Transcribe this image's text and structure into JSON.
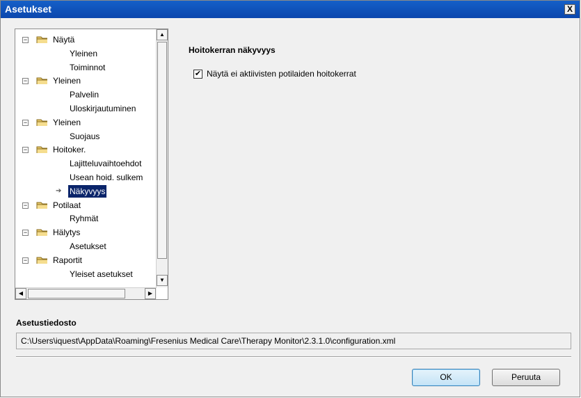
{
  "window": {
    "title": "Asetukset",
    "close_label": "X"
  },
  "tree": {
    "items": [
      {
        "label": "Näytä",
        "level": 0
      },
      {
        "label": "Yleinen",
        "level": 1
      },
      {
        "label": "Toiminnot",
        "level": 1
      },
      {
        "label": "Yleinen",
        "level": 0
      },
      {
        "label": "Palvelin",
        "level": 1
      },
      {
        "label": "Uloskirjautuminen",
        "level": 1
      },
      {
        "label": "Yleinen",
        "level": 0
      },
      {
        "label": "Suojaus",
        "level": 1
      },
      {
        "label": "Hoitoker.",
        "level": 0
      },
      {
        "label": "Lajitteluvaihtoehdot",
        "level": 1
      },
      {
        "label": "Usean hoid. sulkem",
        "level": 1
      },
      {
        "label": "Näkyvyys",
        "level": 1,
        "selected": true
      },
      {
        "label": "Potilaat",
        "level": 0
      },
      {
        "label": "Ryhmät",
        "level": 1
      },
      {
        "label": "Hälytys",
        "level": 0
      },
      {
        "label": "Asetukset",
        "level": 1
      },
      {
        "label": "Raportit",
        "level": 0
      },
      {
        "label": "Yleiset asetukset",
        "level": 1
      }
    ]
  },
  "content": {
    "section_title": "Hoitokerran näkyvyys",
    "checkbox_label": "Näytä ei aktiivisten potilaiden hoitokerrat",
    "checkbox_checked": true,
    "checkbox_mark": "✔"
  },
  "settings_file": {
    "heading": "Asetustiedosto",
    "path": "C:\\Users\\iquest\\AppData\\Roaming\\Fresenius Medical Care\\Therapy Monitor\\2.3.1.0\\configuration.xml"
  },
  "buttons": {
    "ok": "OK",
    "cancel": "Peruuta"
  },
  "colors": {
    "titlebar": "#0b47ad",
    "selection": "#0a246a",
    "folder": "#e7c86a"
  }
}
